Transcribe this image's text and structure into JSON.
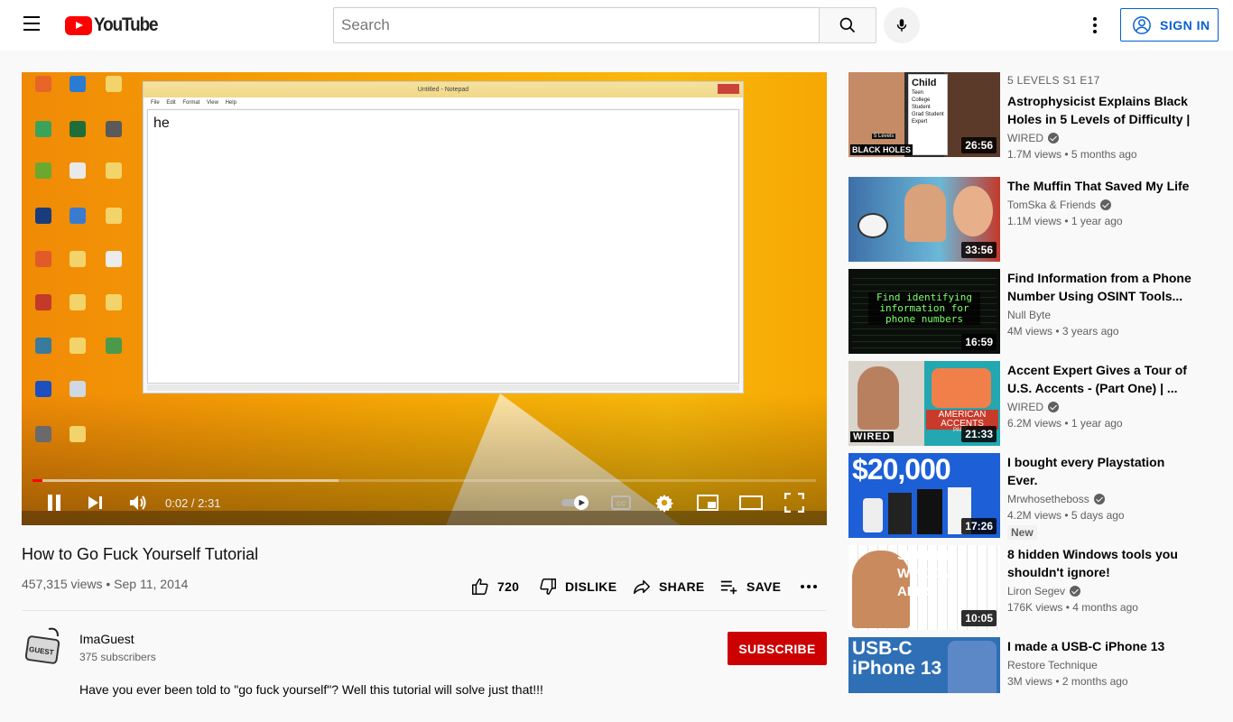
{
  "header": {
    "logo_text": "YouTube",
    "search_placeholder": "Search",
    "signin_label": "SIGN IN"
  },
  "player": {
    "notepad_title": "Untitled - Notepad",
    "notepad_menu": "File Edit Format View Help",
    "notepad_text": "he",
    "time_current": "0:02",
    "time_total": "2:31",
    "time_display": "0:02 / 2:31",
    "played_fraction": 0.013,
    "buffered_fraction": 0.39
  },
  "video": {
    "title": "How to Go Fuck Yourself Tutorial",
    "meta": "457,315 views • Sep 11, 2014",
    "like_count": "720",
    "dislike_label": "DISLIKE",
    "share_label": "SHARE",
    "save_label": "SAVE"
  },
  "channel": {
    "name": "ImaGuest",
    "subscribers": "375 subscribers",
    "subscribe_label": "SUBSCRIBE",
    "avatar_text": "GUEST",
    "description": "Have you ever been told to \"go fuck yourself\"? Well this tutorial will solve just that!!!"
  },
  "recommendations": [
    {
      "kicker": "5 LEVELS   S1 E17",
      "title": "Astrophysicist Explains Black Holes in 5 Levels of Difficulty | ...",
      "channel": "WIRED",
      "verified": true,
      "stats": "1.7M views • 5 months ago",
      "duration": "26:56",
      "thumb_color": "#2b2b2b"
    },
    {
      "title": "The Muffin That Saved My Life",
      "channel": "TomSka & Friends",
      "verified": true,
      "stats": "1.1M views • 1 year ago",
      "duration": "33:56",
      "thumb_color": "#3e6fa8"
    },
    {
      "title": "Find Information from a Phone Number Using OSINT Tools...",
      "channel": "Null Byte",
      "verified": false,
      "stats": "4M views • 3 years ago",
      "duration": "16:59",
      "thumb_color": "#0b0f0b"
    },
    {
      "title": "Accent Expert Gives a Tour of U.S. Accents - (Part One) | ...",
      "channel": "WIRED",
      "verified": true,
      "stats": "6.2M views • 1 year ago",
      "duration": "21:33",
      "thumb_color": "#d9d4cc"
    },
    {
      "title": "I bought every Playstation Ever.",
      "channel": "Mrwhosetheboss",
      "verified": true,
      "stats": "4.2M views • 5 days ago",
      "badge": "New",
      "duration": "17:26",
      "thumb_color": "#1d5fd6"
    },
    {
      "title": "8 hidden Windows tools you shouldn't ignore!",
      "channel": "Liron Segev",
      "verified": true,
      "stats": "176K views • 4 months ago",
      "duration": "10:05",
      "thumb_color": "#f1f1f1"
    },
    {
      "title": "I made a USB-C iPhone 13",
      "channel": "Restore Technique",
      "verified": false,
      "stats": "3M views • 2 months ago",
      "duration": "",
      "thumb_color": "#2e6fb5"
    }
  ],
  "thumb_text": {
    "r0_level": "Child",
    "r0_levels": [
      "Teen",
      "College Student",
      "Grad Student",
      "Expert"
    ],
    "r0_badge": "5 Levels",
    "r0_caption": "BLACK HOLES",
    "r2_overlay": "Find identifying information for phone numbers",
    "r3_caption": "AMERICAN ACCENTS",
    "r3_brand": "WIRED",
    "r3_part": "PART",
    "r4_price": "$20,000",
    "r5_text": "SECRET WINDOWS APPS",
    "r6_text": "USB-C iPhone 13"
  },
  "colors": {
    "brand_red": "#ff0000",
    "subscribe_red": "#cc0000",
    "signin_blue": "#065fd4"
  }
}
